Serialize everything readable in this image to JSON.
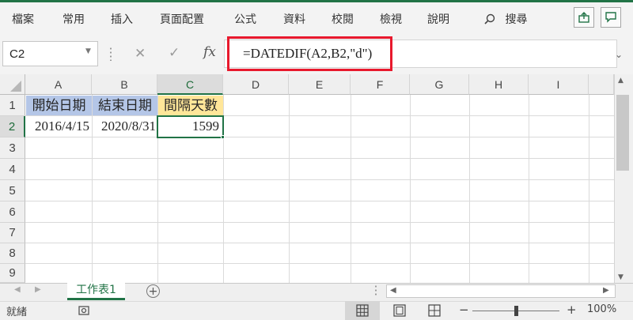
{
  "ribbon": {
    "tabs": [
      "檔案",
      "常用",
      "插入",
      "頁面配置",
      "公式",
      "資料",
      "校閱",
      "檢視",
      "說明"
    ],
    "search_label": "搜尋"
  },
  "formula_bar": {
    "name_box": "C2",
    "formula": "=DATEDIF(A2,B2,\"d\")",
    "fx_label": "fx"
  },
  "grid": {
    "columns": [
      "A",
      "B",
      "C",
      "D",
      "E",
      "F",
      "G",
      "H",
      "I"
    ],
    "selected_column": "C",
    "rows": [
      "1",
      "2",
      "3",
      "4",
      "5",
      "6",
      "7",
      "8",
      "9"
    ],
    "selected_row": "2",
    "cells": {
      "A1": "開始日期",
      "B1": "結束日期",
      "C1": "間隔天數",
      "A2": "2016/4/15",
      "B2": "2020/8/31",
      "C2": "1599"
    },
    "fill_colors": {
      "A1": "#b4c6e7",
      "B1": "#b4c6e7",
      "C1": "#ffe699"
    }
  },
  "sheets": {
    "tabs": [
      "工作表1"
    ],
    "active": "工作表1"
  },
  "status_bar": {
    "mode": "就緒",
    "zoom_percent": "100%",
    "zoom_level": 100
  },
  "colors": {
    "accent": "#217346",
    "highlight": "#e8192d"
  }
}
